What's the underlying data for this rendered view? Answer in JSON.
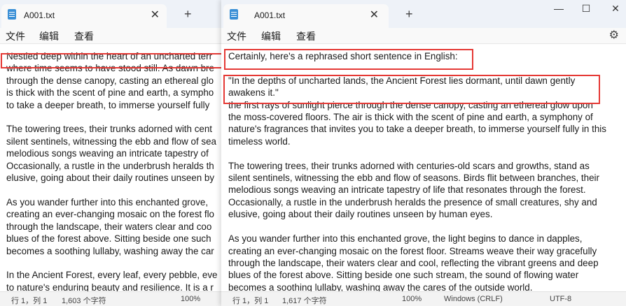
{
  "left_window": {
    "tab_title": "A001.txt",
    "close_glyph": "✕",
    "new_tab_glyph": "+",
    "menu": [
      "文件",
      "编辑",
      "查看"
    ],
    "lines": [
      "Nestled deep within the heart of an uncharted terr",
      "where time seems to have stood still. As dawn bre",
      "through the dense canopy, casting an ethereal glo",
      "is thick with the scent of pine and earth, a sympho",
      "to take a deeper breath, to immerse yourself fully",
      "",
      "The towering trees, their trunks adorned with cent",
      "silent sentinels, witnessing the ebb and flow of sea",
      "melodious songs weaving an intricate tapestry of",
      "Occasionally, a rustle in the underbrush heralds th",
      "elusive, going about their daily routines unseen by",
      "",
      "As you wander further into this enchanted grove,",
      "creating an ever-changing mosaic on the forest flo",
      "through the landscape, their waters clear and coo",
      "blues of the forest above. Sitting beside one such",
      "becomes a soothing lullaby, washing away the car",
      "",
      "In the Ancient Forest, every leaf, every pebble, eve",
      "to nature's enduring beauty and resilience. It is a r"
    ],
    "status": {
      "position": "行 1，列 1",
      "chars": "1,603 个字符",
      "zoom": "100%"
    }
  },
  "right_window": {
    "tab_title": "A001.txt",
    "close_glyph": "✕",
    "new_tab_glyph": "+",
    "controls": {
      "minimize": "—",
      "maximize": "☐",
      "close": "✕"
    },
    "settings_glyph": "⚙",
    "menu": [
      "文件",
      "编辑",
      "查看"
    ],
    "lines": [
      "Certainly, here's a rephrased short sentence in English:",
      "",
      "\"In the depths of uncharted lands, the Ancient Forest lies dormant, until dawn gently",
      "awakens it.\"",
      "the first rays of sunlight pierce through the dense canopy, casting an ethereal glow upon",
      "the moss-covered floors. The air is thick with the scent of pine and earth, a symphony of",
      "nature's fragrances that invites you to take a deeper breath, to immerse yourself fully in this",
      "timeless world.",
      "",
      "The towering trees, their trunks adorned with centuries-old scars and growths, stand as",
      "silent sentinels, witnessing the ebb and flow of seasons. Birds flit between branches, their",
      "melodious songs weaving an intricate tapestry of life that resonates through the forest.",
      "Occasionally, a rustle in the underbrush heralds the presence of small creatures, shy and",
      "elusive, going about their daily routines unseen by human eyes.",
      "",
      "As you wander further into this enchanted grove, the light begins to dance in dapples,",
      "creating an ever-changing mosaic on the forest floor. Streams weave their way gracefully",
      "through the landscape, their waters clear and cool, reflecting the vibrant greens and deep",
      "blues of the forest above. Sitting beside one such stream, the sound of flowing water",
      "becomes a soothing lullaby, washing away the cares of the outside world."
    ],
    "status": {
      "position": "行 1，列 1",
      "chars": "1,617 个字符",
      "zoom": "100%",
      "line_ending": "Windows (CRLF)",
      "encoding": "UTF-8"
    }
  },
  "colors": {
    "highlight_box": "#e53935",
    "titlebar": "#eef2f8",
    "notepad_icon": "#3a8fd6"
  },
  "icons": {
    "app": "notepad-icon",
    "settings": "gear-icon",
    "close": "close-icon"
  }
}
